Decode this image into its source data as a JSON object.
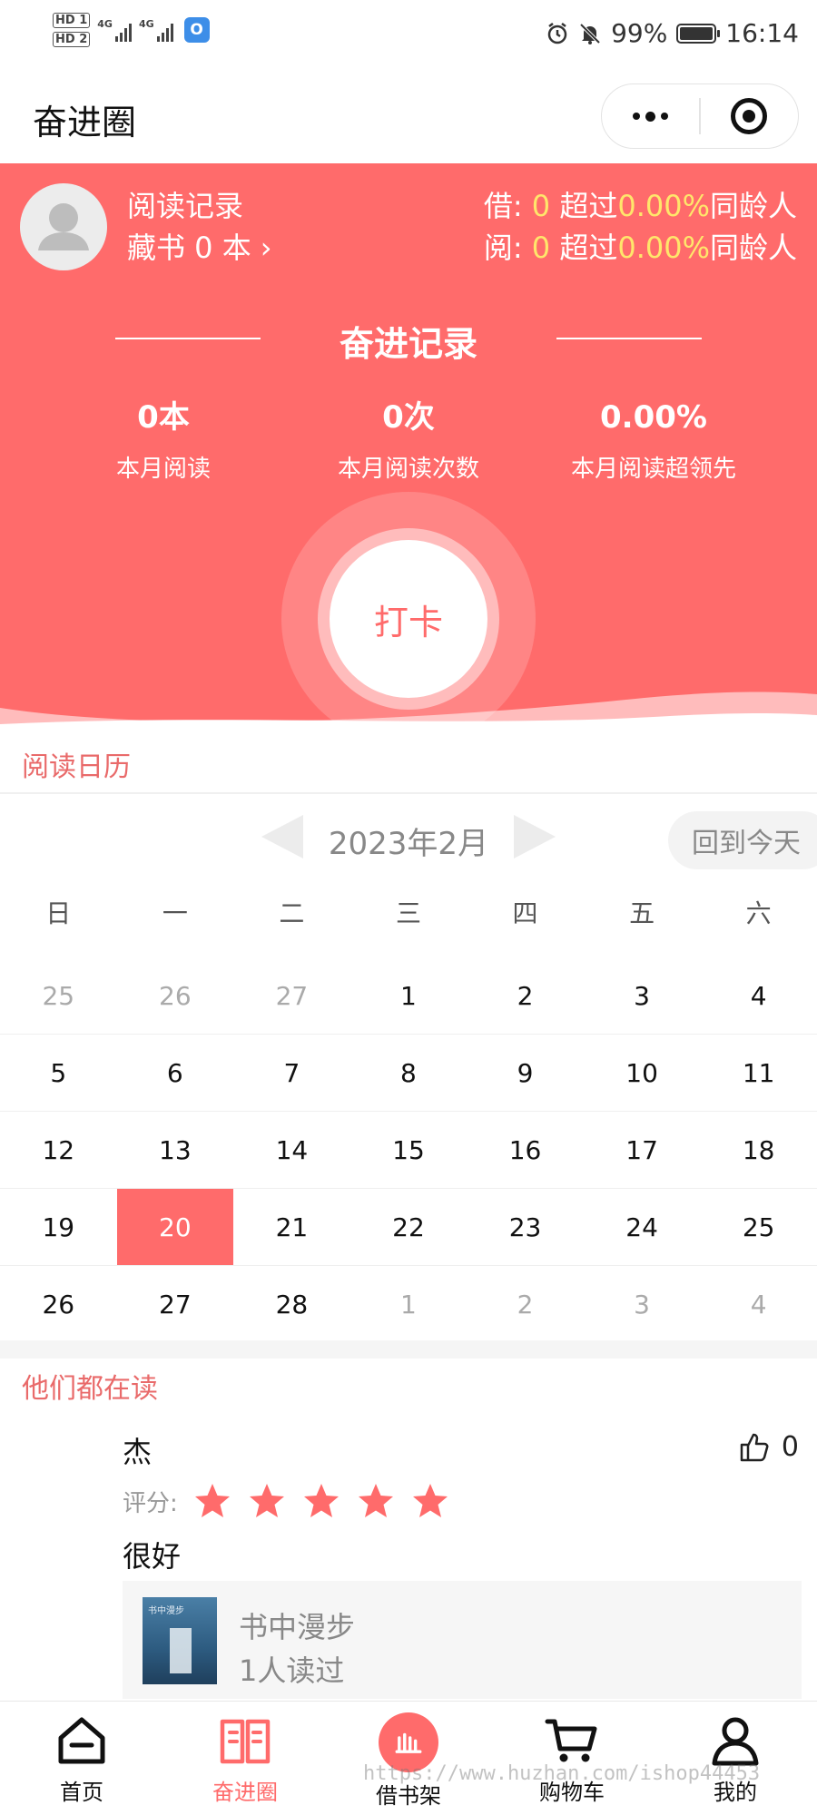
{
  "status_bar": {
    "hd1": "HD 1",
    "hd2": "HD 2",
    "net1": "4G",
    "net2": "4G",
    "app_badge": "O",
    "battery": "99%",
    "time": "16:14"
  },
  "title_bar": {
    "title": "奋进圈"
  },
  "profile": {
    "record_label": "阅读记录",
    "collection": "藏书 0 本",
    "borrow_label": "借:",
    "borrow_value": "0",
    "read_label": "阅:",
    "read_value": "0",
    "exceed_label": "超过",
    "borrow_percent": "0.00%",
    "read_percent": "0.00%",
    "peers_label": "同龄人"
  },
  "progress": {
    "heading": "奋进记录",
    "metrics": [
      {
        "value": "0本",
        "caption": "本月阅读"
      },
      {
        "value": "0次",
        "caption": "本月阅读次数"
      },
      {
        "value": "0.00%",
        "caption": "本月阅读超领先"
      }
    ],
    "punch_label": "打卡"
  },
  "calendar": {
    "title": "阅读日历",
    "month": "2023年2月",
    "today_button": "回到今天",
    "weekdays": [
      "日",
      "一",
      "二",
      "三",
      "四",
      "五",
      "六"
    ],
    "weeks": [
      [
        {
          "d": "25",
          "dim": true
        },
        {
          "d": "26",
          "dim": true
        },
        {
          "d": "27",
          "dim": true
        },
        {
          "d": "1"
        },
        {
          "d": "2"
        },
        {
          "d": "3"
        },
        {
          "d": "4"
        }
      ],
      [
        {
          "d": "5"
        },
        {
          "d": "6"
        },
        {
          "d": "7"
        },
        {
          "d": "8"
        },
        {
          "d": "9"
        },
        {
          "d": "10"
        },
        {
          "d": "11"
        }
      ],
      [
        {
          "d": "12"
        },
        {
          "d": "13"
        },
        {
          "d": "14"
        },
        {
          "d": "15"
        },
        {
          "d": "16"
        },
        {
          "d": "17"
        },
        {
          "d": "18"
        }
      ],
      [
        {
          "d": "19"
        },
        {
          "d": "20",
          "today": true
        },
        {
          "d": "21"
        },
        {
          "d": "22"
        },
        {
          "d": "23"
        },
        {
          "d": "24"
        },
        {
          "d": "25"
        }
      ],
      [
        {
          "d": "26"
        },
        {
          "d": "27"
        },
        {
          "d": "28"
        },
        {
          "d": "1",
          "dim": true
        },
        {
          "d": "2",
          "dim": true
        },
        {
          "d": "3",
          "dim": true
        },
        {
          "d": "4",
          "dim": true
        }
      ]
    ]
  },
  "feed": {
    "title": "他们都在读",
    "post": {
      "user": "杰",
      "likes": "0",
      "rating_label": "评分:",
      "rating": 5,
      "comment": "很好",
      "book": {
        "cover_text": "书中漫步",
        "name": "书中漫步",
        "readers": "1人读过"
      }
    }
  },
  "tab_bar": {
    "items": [
      {
        "label": "首页",
        "icon": "home-icon"
      },
      {
        "label": "奋进圈",
        "icon": "book-icon"
      },
      {
        "label": "借书架",
        "icon": "bookshelf-icon"
      },
      {
        "label": "购物车",
        "icon": "cart-icon"
      },
      {
        "label": "我的",
        "icon": "user-icon"
      }
    ],
    "active_index": 1
  },
  "watermark": "https://www.huzhan.com/ishop44453",
  "colors": {
    "accent": "#ff6b6b",
    "highlight": "#ffe66b",
    "section_title": "#e96a6a"
  }
}
